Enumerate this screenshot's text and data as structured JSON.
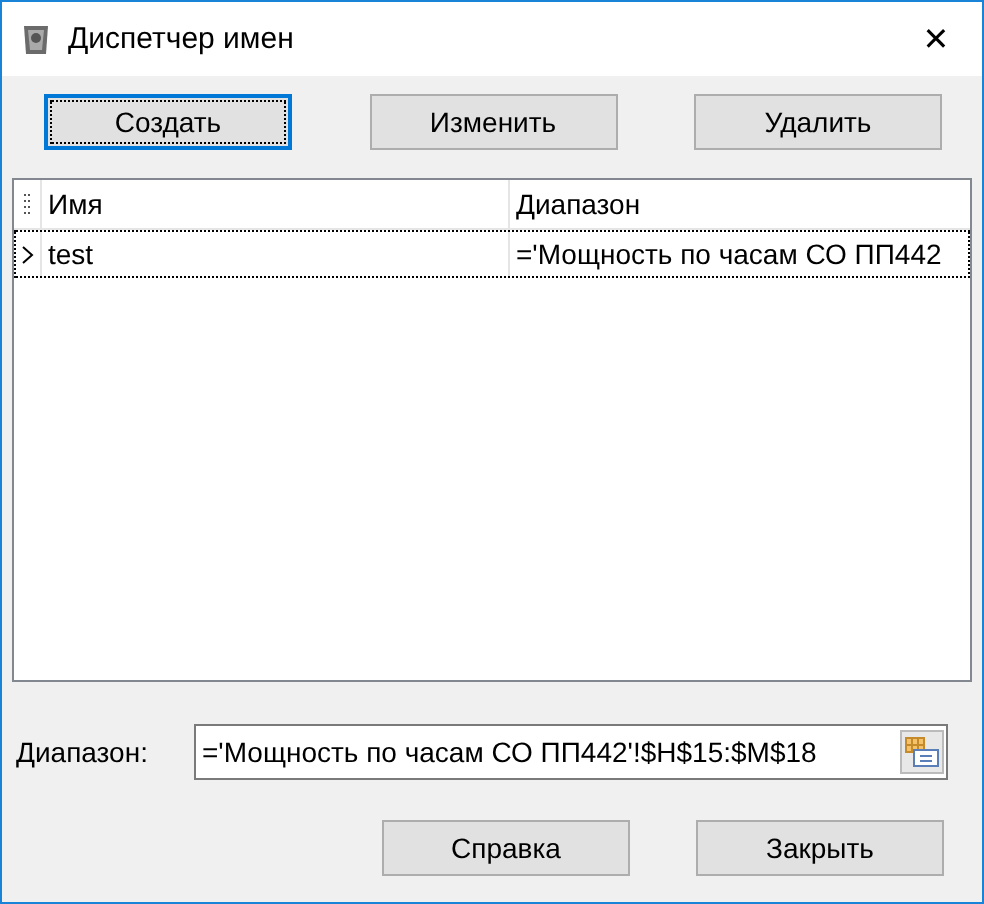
{
  "window": {
    "title": "Диспетчер имен",
    "close": "✕"
  },
  "buttons": [
    {
      "label": "Создать",
      "focused": true
    },
    {
      "label": "Изменить",
      "focused": false
    },
    {
      "label": "Удалить",
      "focused": false
    }
  ],
  "table": {
    "columns": [
      "Имя",
      "Диапазон"
    ],
    "rows": [
      {
        "cells": [
          "test",
          "='Мощность по часам СО ПП442"
        ],
        "selected": true
      }
    ]
  },
  "range": {
    "label": "Диапазон:",
    "value": "='Мощность по часам СО ПП442'!$H$15:$M$18"
  },
  "footer_buttons": [
    "Справка",
    "Закрыть"
  ]
}
